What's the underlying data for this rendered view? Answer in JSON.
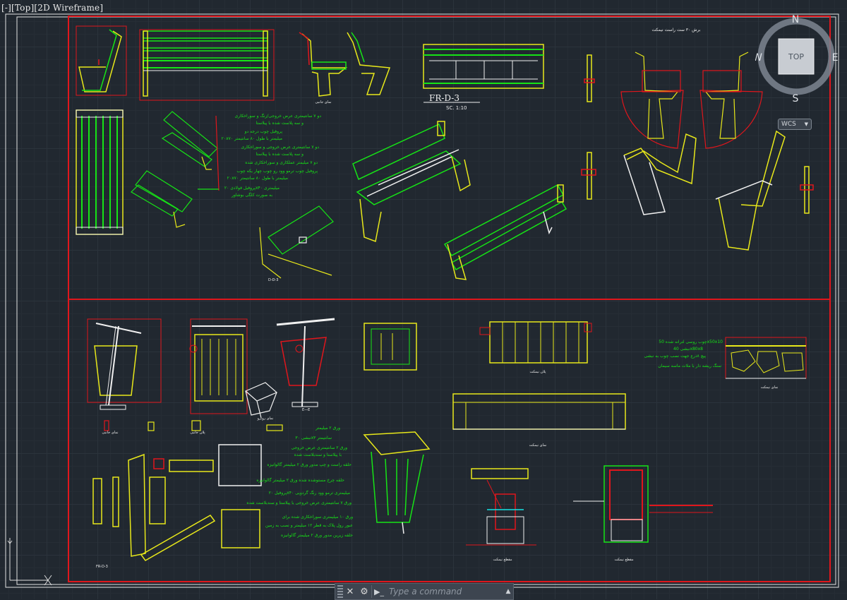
{
  "viewport": {
    "label": "[-][Top][2D Wireframe]"
  },
  "viewcube": {
    "north": "N",
    "south": "S",
    "east": "E",
    "west": "W",
    "face": "TOP",
    "wcs": "WCS"
  },
  "drawing": {
    "title_mark": "FR-D-3",
    "scale": "SC. 1:10",
    "detail_mark_1": "D-D-3",
    "detail_mark_2": "E—E",
    "detail_mark_3": "FR-D-3",
    "notes_top": [
      "دو ۷ سانتیمتری عرض خروجی/زنگ و سوراخکاری",
      "و سه پلاست شده با پیلاستا",
      "پروفیل چوب درجه دو",
      "۲۰x۷۰ میلیمتر با طول ۸۰ سانتیمتر",
      "دو ۷ سانتیمتری عرض خروجی و سوراخکاری",
      "و سه پلاست شده با پیلاستا",
      "دو ۷ میلیمتر عملکاری و سوراخکاری شده",
      "پروفیل چوب ترمو وود رو چوب چهار یکه چوب",
      "۲۰x۷۰ میلیمتر با طول ۸۰ سانتیمتر",
      "پروفیل فولادی ۲۰x۴۰ میلیمتری",
      "به صورت کلگی بوشاور"
    ],
    "notes_bin": [
      "ورق ۲ میلیمتر",
      "نبشی ۳۰x۳ سانتیمتر",
      "ورق ۲ سانتیمتری عرض خروجی",
      "با پیلاستا و سندبلاست شده",
      "حلقه راست و چپ مدور ورق ۲ میلیمتر گالوانیزه",
      "حلقه چرخ مستوشده شده ورق ۲ میلیمتر گالوانیزه",
      "پروفیل ۲۰x۴۰ میلیمتری ترمو وود رنگ گردویی",
      "ورق ۷ سانتیمتری عرض خروجی با پیلاستا و سندبلاست شده",
      "ورق ۱۰ میلیمتری سوراخکاری شده برای",
      "عبور رول پلاک به قطر ۱۲ میلیمتر و نصب به زمین",
      "حلقه زیرین مدور ورق ۲ میلیمتر گالوانیزه"
    ],
    "notes_paving": [
      "چوب روسی لترانه شده 50x50x10",
      "نبشی 40x80x8",
      "پیچ ۸ذرع جهت نصب چوب به نبشی",
      "سنگ ریشه دار با ملات ماسه سیمان"
    ],
    "captions": [
      "نمای جانبی",
      "نمای روبرو",
      "پلان نیمکت",
      "نمای نیمکت",
      "نمای نیمکت",
      "مقطع نیمکت",
      "مقطع نیمکت",
      "نمای جانبی",
      "پلان جانبی",
      "برش ۳۰ ست راست نیمکت"
    ]
  },
  "commandline": {
    "placeholder": "Type a command",
    "close": "✕",
    "settings": "⚙",
    "prompt": "▶_"
  },
  "colors": {
    "background": "#212830",
    "frame": "#e0161c",
    "green": "#16e416",
    "yellow": "#e8e81a",
    "white": "#f0f0f0",
    "grid": "#2b333c"
  }
}
